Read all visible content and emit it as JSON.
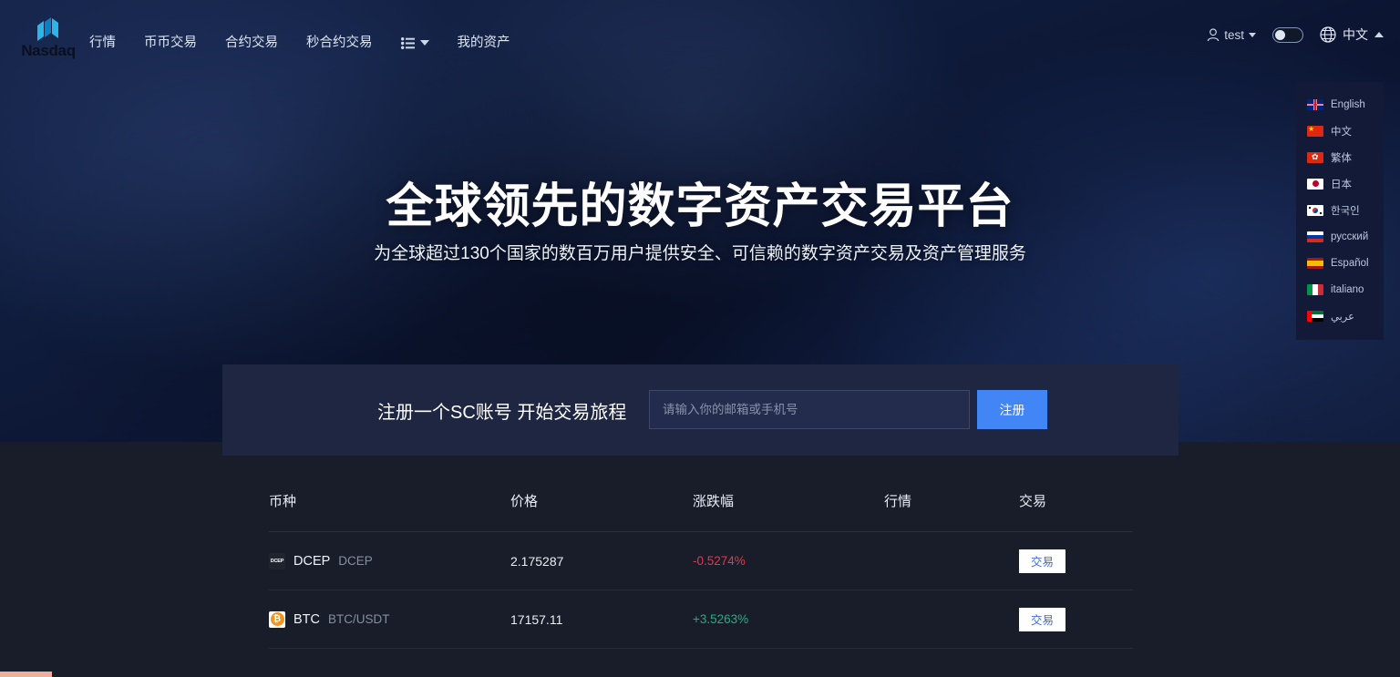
{
  "brand": {
    "logo_name": "nasdaq-logo",
    "logo_word": "Nasdaq"
  },
  "nav": {
    "links": [
      {
        "label": "行情"
      },
      {
        "label": "币币交易"
      },
      {
        "label": "合约交易"
      },
      {
        "label": "秒合约交易"
      }
    ],
    "list_menu_icon": "list-icon",
    "my_assets_label": "我的资产"
  },
  "account": {
    "user_icon": "user-icon",
    "username": "test",
    "theme_toggle": "theme-toggle",
    "globe_icon": "globe-icon",
    "language_label": "中文"
  },
  "language_menu": {
    "items": [
      {
        "label": "English",
        "flag": "f-gb"
      },
      {
        "label": "中文",
        "flag": "f-cn"
      },
      {
        "label": "繁体",
        "flag": "f-hk"
      },
      {
        "label": "日本",
        "flag": "f-jp"
      },
      {
        "label": "한국인",
        "flag": "f-kr"
      },
      {
        "label": "русский",
        "flag": "f-ru"
      },
      {
        "label": "Español",
        "flag": "f-es"
      },
      {
        "label": "italiano",
        "flag": "f-it"
      },
      {
        "label": "عربي",
        "flag": "f-ae"
      }
    ]
  },
  "hero": {
    "title": "全球领先的数字资产交易平台",
    "subtitle": "为全球超过130个国家的数百万用户提供安全、可信赖的数字资产交易及资产管理服务"
  },
  "signup": {
    "heading": "注册一个SC账号 开始交易旅程",
    "placeholder": "请输入你的邮箱或手机号",
    "value": "",
    "button_label": "注册"
  },
  "market_table": {
    "headers": {
      "coin": "币种",
      "price": "价格",
      "change": "涨跌幅",
      "quote": "行情",
      "trade": "交易"
    },
    "rows": [
      {
        "icon": "dcep-icon",
        "symbol": "DCEP",
        "pair": "DCEP",
        "price": "2.175287",
        "change": "-0.5274%",
        "direction": "down",
        "trade_label": "交易"
      },
      {
        "icon": "btc-icon",
        "symbol": "BTC",
        "pair": "BTC/USDT",
        "price": "17157.11",
        "change": "+3.5263%",
        "direction": "up",
        "trade_label": "交易"
      }
    ]
  },
  "colors": {
    "accent_blue": "#4285f4",
    "up_green": "#22b07d",
    "down_red": "#e03b4a",
    "hero_navy": "#0f1c3c",
    "card_navy": "#1e2642",
    "section_dark": "#191d2a",
    "download_bar": "#edae9c"
  }
}
